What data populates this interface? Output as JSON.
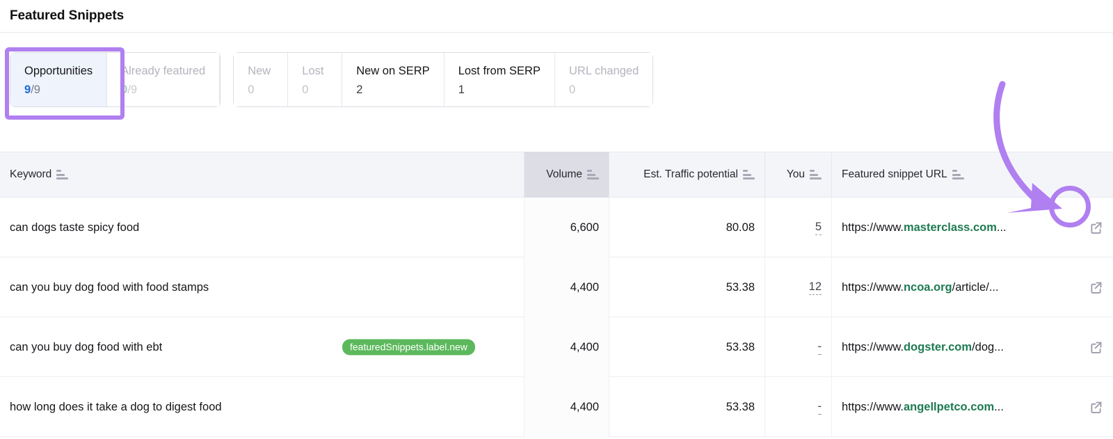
{
  "header": {
    "title": "Featured Snippets"
  },
  "tabGroups": [
    {
      "name": "status-tabs",
      "tabs": [
        {
          "label": "Opportunities",
          "value": "9",
          "total": "/9",
          "state": "selected"
        },
        {
          "label": "Already featured",
          "value": "0",
          "total": "/9",
          "state": "muted-green"
        }
      ]
    },
    {
      "name": "change-tabs",
      "tabs": [
        {
          "label": "New",
          "value": "0",
          "total": "",
          "state": "muted"
        },
        {
          "label": "Lost",
          "value": "0",
          "total": "",
          "state": "muted"
        },
        {
          "label": "New on SERP",
          "value": "2",
          "total": "",
          "state": "normal"
        },
        {
          "label": "Lost from SERP",
          "value": "1",
          "total": "",
          "state": "normal"
        },
        {
          "label": "URL changed",
          "value": "0",
          "total": "",
          "state": "muted"
        }
      ]
    }
  ],
  "table": {
    "columns": [
      {
        "label": "Keyword",
        "sortable": true,
        "sorted": false,
        "align": "left"
      },
      {
        "label": "Volume",
        "sortable": true,
        "sorted": true,
        "align": "right"
      },
      {
        "label": "Est. Traffic potential",
        "sortable": true,
        "sorted": false,
        "align": "right"
      },
      {
        "label": "You",
        "sortable": true,
        "sorted": false,
        "align": "right"
      },
      {
        "label": "Featured snippet URL",
        "sortable": true,
        "sorted": false,
        "align": "left"
      }
    ],
    "rows": [
      {
        "keyword": "can dogs taste spicy food",
        "badge": "",
        "volume": "6,600",
        "traffic": "80.08",
        "you": "5",
        "url_prefix": "https://www.",
        "url_domain": "masterclass.com",
        "url_suffix": "...",
        "link_icon": "external-link-icon"
      },
      {
        "keyword": "can you buy dog food with food stamps",
        "badge": "",
        "volume": "4,400",
        "traffic": "53.38",
        "you": "12",
        "url_prefix": "https://www.",
        "url_domain": "ncoa.org",
        "url_suffix": "/article/...",
        "link_icon": "external-link-icon"
      },
      {
        "keyword": "can you buy dog food with ebt",
        "badge": "featuredSnippets.label.new",
        "volume": "4,400",
        "traffic": "53.38",
        "you": "-",
        "url_prefix": "https://www.",
        "url_domain": "dogster.com",
        "url_suffix": "/dog...",
        "link_icon": "external-link-icon"
      },
      {
        "keyword": "how long does it take a dog to digest food",
        "badge": "",
        "volume": "4,400",
        "traffic": "53.38",
        "you": "-",
        "url_prefix": "https://www.",
        "url_domain": "angellpetco.com",
        "url_suffix": "...",
        "link_icon": "external-link-icon"
      }
    ]
  },
  "annotations": {
    "arrow": {
      "name": "purple-curved-arrow",
      "color": "#b07ff0"
    },
    "circle": {
      "name": "purple-highlight-circle",
      "color": "#b07ff0"
    },
    "box": {
      "name": "purple-highlight-box",
      "color": "#b07ff0"
    }
  },
  "colors": {
    "accent_purple": "#b07ff0",
    "link_blue": "#2068d8",
    "domain_green": "#1e7a53",
    "badge_green": "#5cb85c",
    "header_bg": "#f4f5f9",
    "sorted_col_bg": "#dddde6"
  }
}
